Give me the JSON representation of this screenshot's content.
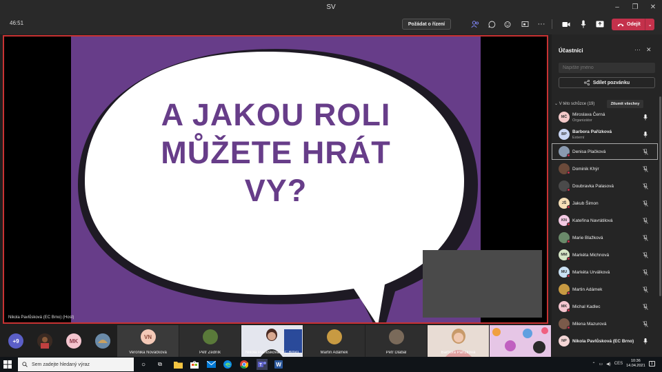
{
  "window": {
    "title": "SV",
    "controls": [
      "–",
      "❐",
      "✕"
    ]
  },
  "toolbar": {
    "timer": "46:51",
    "request_control_label": "Požádat o řízení",
    "leave_label": "Odejít"
  },
  "slide": {
    "lines": [
      "A JAKOU ROLI",
      "MŮŽETE HRÁT",
      "VY?"
    ],
    "background_color": "#673d89",
    "text_color": "#673d89"
  },
  "stage": {
    "presenter_label": "Nikola Pavlůsková (EC Brno) (Host)"
  },
  "strip": {
    "overflow": "+9",
    "avatars": [
      {
        "initials": "MK",
        "color": "#f4c5cf"
      }
    ],
    "tiles": [
      {
        "name": "Veronika Nováčková",
        "initials": "VN",
        "color": "#f4c9b7",
        "type": "avatar"
      },
      {
        "name": "Petr Zedník",
        "type": "photo",
        "color": "#5a7a3a"
      },
      {
        "name": "Nikola Pavlůsková (EC Brno)",
        "type": "video",
        "color": "#d8d8e8"
      },
      {
        "name": "Martin Adámek",
        "type": "photo",
        "color": "#c89a42"
      },
      {
        "name": "Petr Dlabal",
        "type": "photo",
        "color": "#7a6a5a"
      },
      {
        "name": "Barbora Pařízková",
        "type": "video",
        "color": "#d8b8a8"
      }
    ]
  },
  "panel": {
    "title": "Účastníci",
    "search_placeholder": "Napište jméno",
    "share_invite_label": "Sdílet pozvánku",
    "section_label": "V této schůzce (19)",
    "mute_all_label": "Ztlumit všechny",
    "participants": [
      {
        "name": "Miroslava Černá",
        "role": "Organizátor",
        "initials": "MČ",
        "color": "#f3c9c9",
        "mic": "on",
        "bold": false
      },
      {
        "name": "Barbora Pařízková",
        "role": "Externí",
        "initials": "BP",
        "color": "#c9d6f3",
        "mic": "on",
        "bold": true
      },
      {
        "name": "Denisa Plačková",
        "role": "",
        "initials": "",
        "color": "#8a9ab0",
        "mic": "off",
        "bold": false,
        "selected": true
      },
      {
        "name": "Dominik Khýr",
        "role": "",
        "initials": "",
        "color": "#6b4a3a",
        "mic": "off",
        "bold": false
      },
      {
        "name": "Doubravka Palasová",
        "role": "",
        "initials": "",
        "color": "#4a4a4a",
        "mic": "off",
        "bold": false
      },
      {
        "name": "Jakub Šimon",
        "role": "",
        "initials": "JŠ",
        "color": "#f6dfb7",
        "mic": "off",
        "bold": false
      },
      {
        "name": "Kateřina Navrátilová",
        "role": "",
        "initials": "KN",
        "color": "#f3c9e3",
        "mic": "off",
        "bold": false
      },
      {
        "name": "Marie Blažková",
        "role": "",
        "initials": "",
        "color": "#6a8a6a",
        "mic": "off",
        "bold": false
      },
      {
        "name": "Markéta Michnová",
        "role": "",
        "initials": "MM",
        "color": "#d6e6c6",
        "mic": "off",
        "bold": false
      },
      {
        "name": "Markéta Urválková",
        "role": "",
        "initials": "MU",
        "color": "#c9e0f3",
        "mic": "off",
        "bold": false
      },
      {
        "name": "Martin Adámek",
        "role": "",
        "initials": "",
        "color": "#c89a42",
        "mic": "off",
        "bold": false
      },
      {
        "name": "Michal Kadlec",
        "role": "",
        "initials": "MK",
        "color": "#f4c5cf",
        "mic": "off",
        "bold": false
      },
      {
        "name": "Milena Mazurová",
        "role": "",
        "initials": "",
        "color": "#7a5a4a",
        "mic": "off",
        "bold": false
      },
      {
        "name": "Nikola Pavlůsková (EC Brno)",
        "role": "",
        "initials": "NP",
        "color": "#f4d6d6",
        "mic": "on",
        "bold": true
      }
    ]
  },
  "taskbar": {
    "search_placeholder": "Sem zadejte hledaný výraz",
    "language": "CES",
    "time": "10:36",
    "date": "14.04.2021",
    "notification_count": "1"
  }
}
